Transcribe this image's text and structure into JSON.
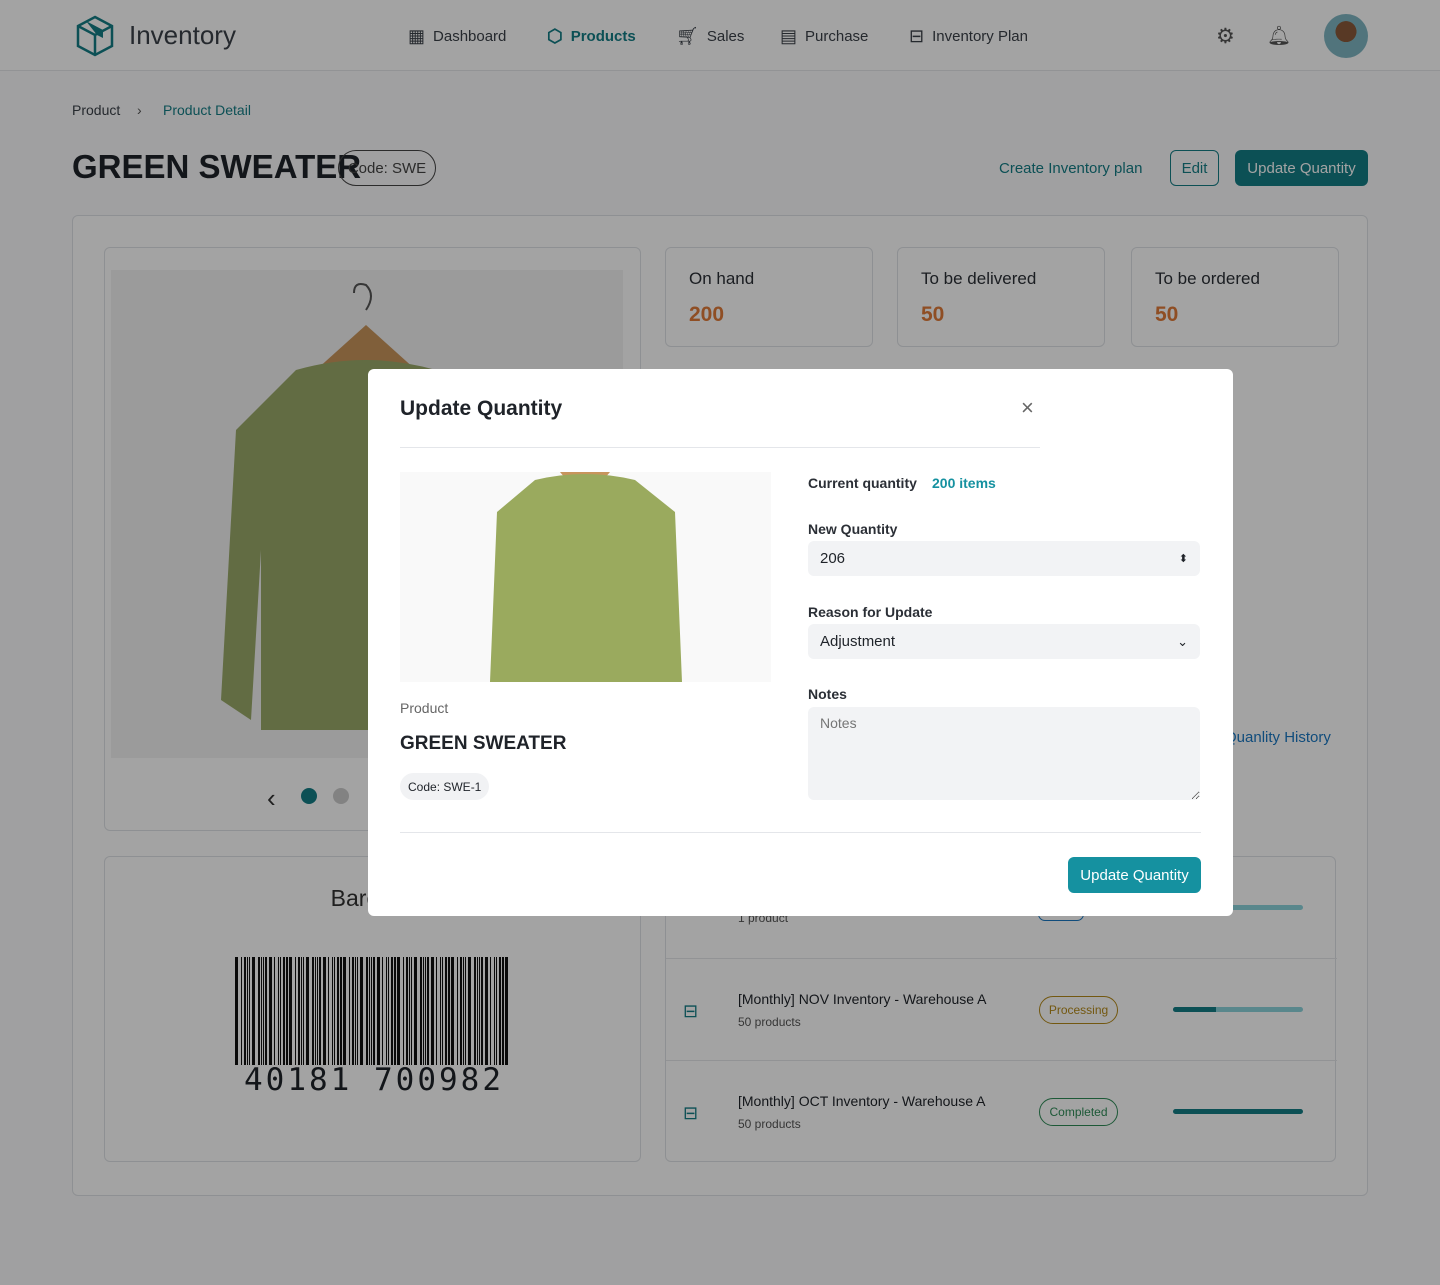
{
  "app": {
    "name": "Inventory"
  },
  "nav": [
    {
      "label": "Dashboard",
      "icon": "grid-icon"
    },
    {
      "label": "Products",
      "icon": "box-icon",
      "active": true
    },
    {
      "label": "Sales",
      "icon": "cart-icon"
    },
    {
      "label": "Purchase",
      "icon": "receipt-icon"
    },
    {
      "label": "Inventory Plan",
      "icon": "archive-icon"
    }
  ],
  "breadcrumb": {
    "parent": "Product",
    "current": "Product Detail"
  },
  "product": {
    "title": "GREEN SWEATER",
    "code": "Code: SWE"
  },
  "actions": {
    "create_plan": "Create Inventory plan",
    "edit": "Edit",
    "update": "Update Quantity"
  },
  "stats": [
    {
      "label": "On hand",
      "value": "200"
    },
    {
      "label": "To be delivered",
      "value": "50"
    },
    {
      "label": "To be ordered",
      "value": "50"
    }
  ],
  "history_link": "Quanlity History",
  "barcode": {
    "title": "Barcode",
    "number": "40181 700982"
  },
  "plans": [
    {
      "title": "",
      "subtitle": "1 product",
      "status": "",
      "progress": 0.85
    },
    {
      "title": "[Monthly] NOV Inventory - Warehouse A",
      "subtitle": "50 products",
      "status": "Processing",
      "progress": 0.33
    },
    {
      "title": "[Monthly] OCT Inventory - Warehouse A",
      "subtitle": "50 products",
      "status": "Completed",
      "progress": 1.0
    }
  ],
  "modal": {
    "title": "Update Quantity",
    "product_label": "Product",
    "product_name": "GREEN SWEATER",
    "product_code": "Code: SWE-1",
    "current_label": "Current quantity",
    "current_value": "200 items",
    "new_qty_label": "New Quantity",
    "new_qty_value": "206",
    "reason_label": "Reason for Update",
    "reason_value": "Adjustment",
    "notes_label": "Notes",
    "notes_placeholder": "Notes",
    "submit": "Update Quantity"
  },
  "colors": {
    "accent": "#1591a0",
    "brand": "#147d86",
    "stat": "#e07b39",
    "processing": "#b58a1a",
    "completed": "#2e8b57"
  }
}
